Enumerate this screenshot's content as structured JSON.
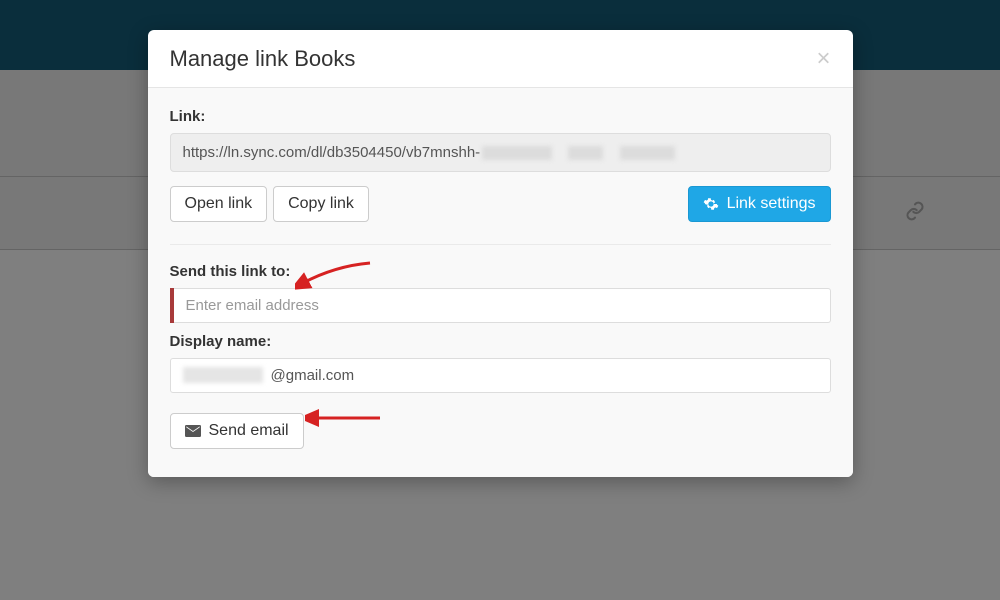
{
  "modal": {
    "title": "Manage link Books",
    "link_label": "Link:",
    "link_url": "https://ln.sync.com/dl/db3504450/vb7mnshh-",
    "open_link": "Open link",
    "copy_link": "Copy link",
    "link_settings": "Link settings",
    "send_label": "Send this link to:",
    "email_placeholder": "Enter email address",
    "display_name_label": "Display name:",
    "display_name_value": "@gmail.com",
    "send_email": "Send email"
  }
}
